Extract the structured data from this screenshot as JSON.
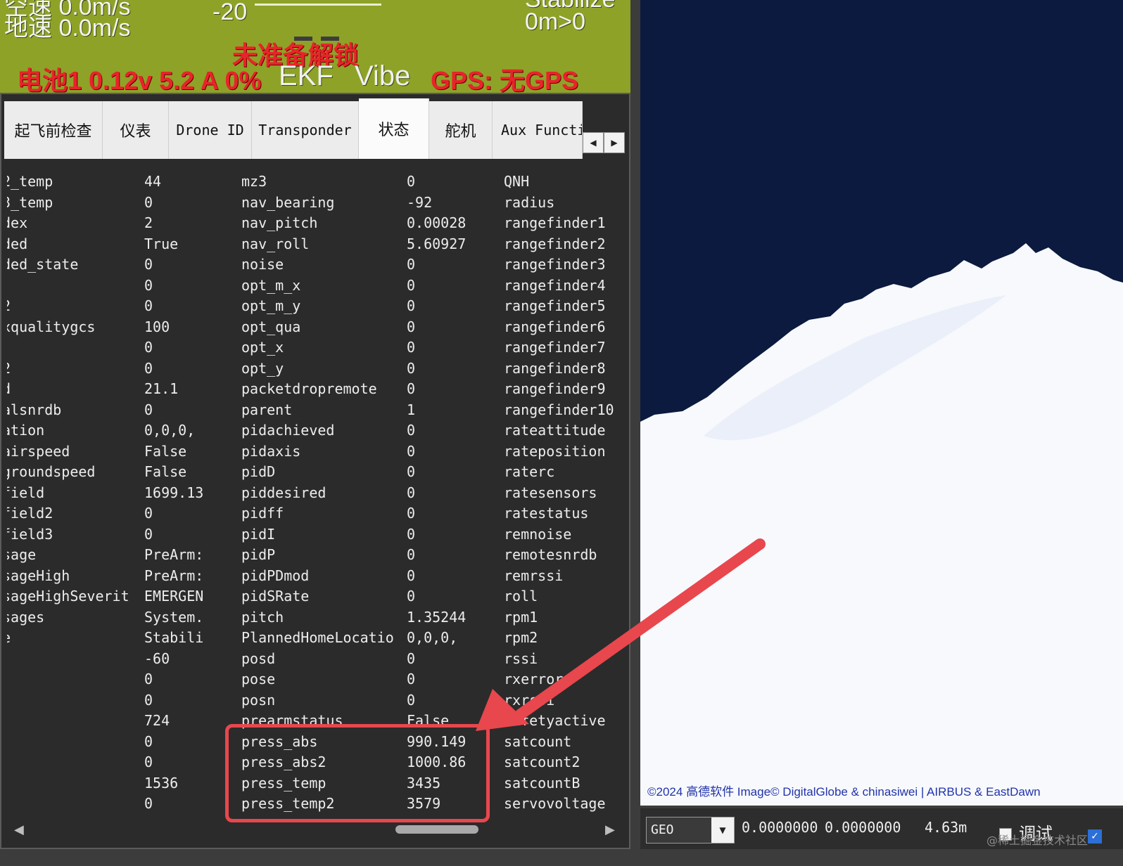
{
  "hud": {
    "top_line1": "空速 0.0m/s",
    "ground_speed": "地速 0.0m/s",
    "pitch_scale": "-20",
    "mode": "Stabilize",
    "distance": "0m>0",
    "arm_status": "未准备解锁",
    "battery": "电池1 0.12v 5.2 A 0%",
    "ekf": "EKF",
    "vibe": "Vibe",
    "gps": "GPS: 无GPS"
  },
  "tabs": [
    {
      "label": "起飞前检查"
    },
    {
      "label": "仪表"
    },
    {
      "label": "Drone ID"
    },
    {
      "label": "Transponder"
    },
    {
      "label": "状态"
    },
    {
      "label": "舵机"
    },
    {
      "label": "Aux Functi"
    }
  ],
  "status_rows": [
    [
      "2_temp",
      "44",
      "mz3",
      "0",
      "QNH"
    ],
    [
      "3_temp",
      "0",
      "nav_bearing",
      "-92",
      "radius"
    ],
    [
      "dex",
      "2",
      "nav_pitch",
      "0.00028",
      "rangefinder1"
    ],
    [
      "ded",
      "True",
      "nav_roll",
      "5.60927",
      "rangefinder2"
    ],
    [
      "ded_state",
      "0",
      "noise",
      "0",
      "rangefinder3"
    ],
    [
      "",
      "0",
      "opt_m_x",
      "0",
      "rangefinder4"
    ],
    [
      "2",
      "0",
      "opt_m_y",
      "0",
      "rangefinder5"
    ],
    [
      "xqualitygcs",
      "100",
      "opt_qua",
      "0",
      "rangefinder6"
    ],
    [
      "",
      "0",
      "opt_x",
      "0",
      "rangefinder7"
    ],
    [
      "2",
      "0",
      "opt_y",
      "0",
      "rangefinder8"
    ],
    [
      "d",
      "21.1",
      "packetdropremote",
      "0",
      "rangefinder9"
    ],
    [
      "alsnrdb",
      "0",
      "parent",
      "1",
      "rangefinder10"
    ],
    [
      "ation",
      "0,0,0,",
      "pidachieved",
      "0",
      "rateattitude"
    ],
    [
      "airspeed",
      "False",
      "pidaxis",
      "0",
      "rateposition"
    ],
    [
      "groundspeed",
      "False",
      "pidD",
      "0",
      "raterc"
    ],
    [
      "field",
      "1699.13",
      "piddesired",
      "0",
      "ratesensors"
    ],
    [
      "field2",
      "0",
      "pidff",
      "0",
      "ratestatus"
    ],
    [
      "field3",
      "0",
      "pidI",
      "0",
      "remnoise"
    ],
    [
      "sage",
      "PreArm:",
      "pidP",
      "0",
      "remotesnrdb"
    ],
    [
      "sageHigh",
      "PreArm:",
      "pidPDmod",
      "0",
      "remrssi"
    ],
    [
      "sageHighSeverit",
      "EMERGEN",
      "pidSRate",
      "0",
      "roll"
    ],
    [
      "sages",
      "System.",
      "pitch",
      "1.35244",
      "rpm1"
    ],
    [
      "e",
      "Stabili",
      "PlannedHomeLocatio",
      "0,0,0,",
      "rpm2"
    ],
    [
      "",
      "-60",
      "posd",
      "0",
      "rssi"
    ],
    [
      "",
      "0",
      "pose",
      "0",
      "rxerrors"
    ],
    [
      "",
      "0",
      "posn",
      "0",
      "rxrssi"
    ],
    [
      "",
      "724",
      "prearmstatus",
      "False",
      "safetyactive"
    ],
    [
      "",
      "0",
      "press_abs",
      "990.149",
      "satcount"
    ],
    [
      "",
      "0",
      "press_abs2",
      "1000.86",
      "satcount2"
    ],
    [
      "",
      "1536",
      "press_temp",
      "3435",
      "satcountB"
    ],
    [
      "",
      "0",
      "press_temp2",
      "3579",
      "servovoltage"
    ]
  ],
  "map": {
    "credit": "©2024 高德软件 Image© DigitalGlobe & chinasiwei | AIRBUS & EastDawn"
  },
  "statusbar": {
    "coord_system": "GEO",
    "lat": "0.0000000",
    "lng": "0.0000000",
    "alt": "4.63m",
    "debug_label": "调试",
    "watermark": "@稀土掘金技术社区"
  },
  "colors": {
    "hud_bg": "#8ea228",
    "hud_red": "#e8242a",
    "highlight": "#e8474d",
    "map_sea": "#0b1a3e",
    "map_ice": "#f7f9fd"
  }
}
